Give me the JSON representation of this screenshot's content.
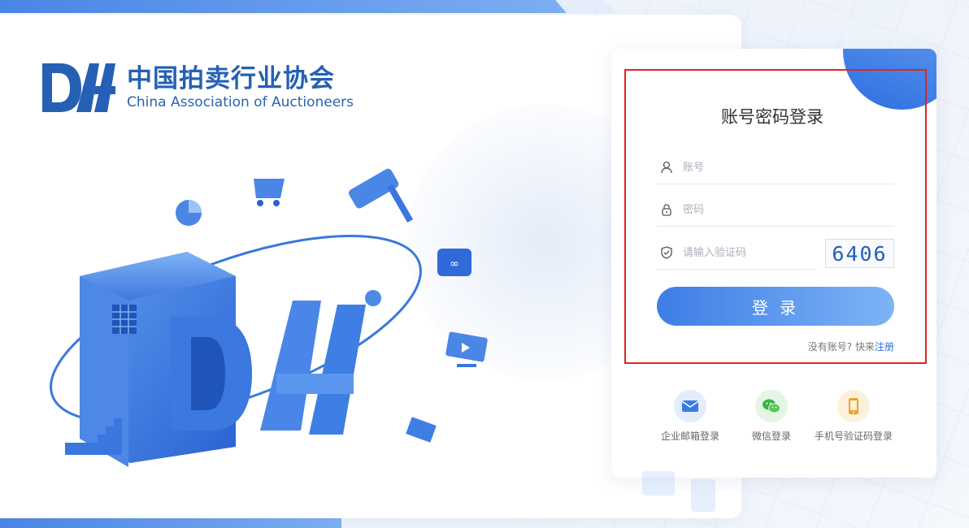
{
  "brand": {
    "name_cn": "中国拍卖行业协会",
    "name_en": "China Association of Auctioneers"
  },
  "login": {
    "title": "账号密码登录",
    "account_placeholder": "账号",
    "password_placeholder": "密码",
    "captcha_placeholder": "请输入验证码",
    "captcha_code": "6406",
    "submit_label": "登 录",
    "no_account_text": "没有账号? 快来",
    "register_link": "注册"
  },
  "alt_logins": [
    {
      "label": "企业邮箱登录",
      "icon": "mail-icon",
      "color": "#3a7be0"
    },
    {
      "label": "微信登录",
      "icon": "wechat-icon",
      "color": "#3cb34a"
    },
    {
      "label": "手机号验证码登录",
      "icon": "phone-icon",
      "color": "#f0a020"
    }
  ],
  "colors": {
    "accent": "#3d7ee6",
    "brand": "#2560b4",
    "highlight": "#e02424"
  }
}
